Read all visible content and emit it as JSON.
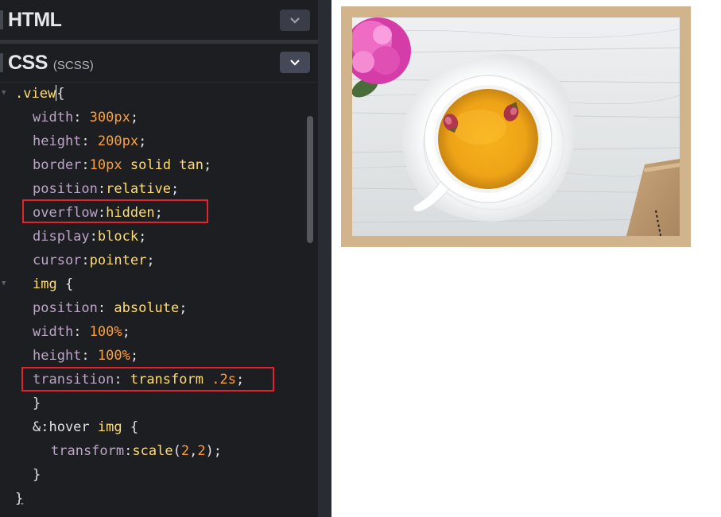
{
  "html_panel": {
    "title": "HTML"
  },
  "css_panel": {
    "title": "CSS",
    "subtitle": "(SCSS)"
  },
  "code": {
    "l1": ".view",
    "l1_brace": "{",
    "l2": [
      "width",
      "300px"
    ],
    "l3": [
      "height",
      "200px"
    ],
    "l4": [
      "border",
      "10px",
      "solid tan"
    ],
    "l5": [
      "position",
      "relative"
    ],
    "l6": [
      "overflow",
      "hidden"
    ],
    "l7": [
      "display",
      "block"
    ],
    "l8": [
      "cursor",
      "pointer"
    ],
    "l9": "img",
    "l10": [
      "position",
      "absolute"
    ],
    "l11": [
      "width",
      "100%"
    ],
    "l12": [
      "height",
      "100%"
    ],
    "l13": [
      "transition",
      "transform",
      ".2s"
    ],
    "l14": "}",
    "l15": [
      "&:hover",
      "img"
    ],
    "l16": [
      "transform",
      "scale",
      "2",
      "2"
    ],
    "l17": "}",
    "l18": "}"
  },
  "colors": {
    "editor_bg": "#1d1e22",
    "highlight": "#e3232b",
    "frame": "#d2b48c"
  },
  "icons": {
    "collapse": "chevron-down-icon",
    "fold": "fold-arrow-icon"
  }
}
